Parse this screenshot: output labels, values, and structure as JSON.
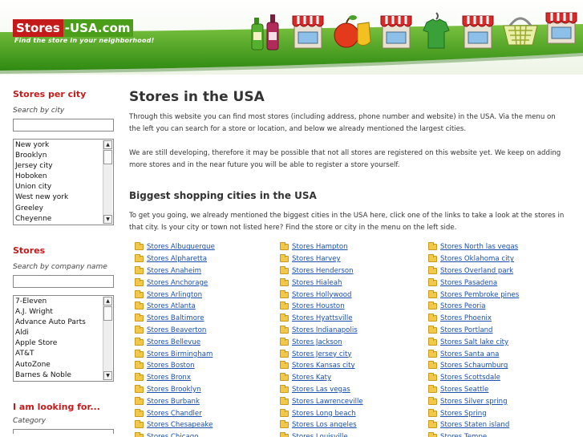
{
  "header": {
    "logo_part1": "Stores",
    "logo_part2": "-USA.com",
    "tagline": "Find the store in your neighborhood!",
    "icons": [
      "bottles-icon",
      "storefront-icon",
      "fruit-icon",
      "storefront-icon",
      "tshirt-icon",
      "storefront-icon",
      "basket-icon",
      "storefront-icon"
    ],
    "colors": {
      "logo_red": "#c41a1a",
      "logo_green": "#4a9e1a",
      "band_green": "#3d9a1c"
    }
  },
  "sidebar": {
    "city": {
      "title": "Stores per city",
      "label": "Search by city",
      "value": "",
      "options": [
        "New york",
        "Brooklyn",
        "Jersey city",
        "Hoboken",
        "Union city",
        "West new york",
        "Greeley",
        "Cheyenne"
      ]
    },
    "company": {
      "title": "Stores",
      "label": "Search by company name",
      "value": "",
      "options": [
        "7-Eleven",
        "A.J. Wright",
        "Advance Auto Parts",
        "Aldi",
        "Apple Store",
        "AT&T",
        "AutoZone",
        "Barnes & Noble"
      ]
    },
    "looking": {
      "title": "I am looking for...",
      "label": "Category"
    }
  },
  "main": {
    "title": "Stores in the USA",
    "intro": "Through this website you can find most stores (including address, phone number and website) in the USA. Via the menu on the left you can search for a store or location, and below we already mentioned the largest cities.",
    "dev_note": "We are still developing, therefore it may be possible that not all stores are registered on this website yet. We keep on adding more stores and in the near future you will be able to register a store yourself.",
    "subtitle": "Biggest shopping cities in the USA",
    "sub_intro": "To get you going, we already mentioned the biggest cities in the USA here, click one of the links to take a look at the stores in that city. Is your city or town not listed here? Find the store or city in the menu on the left side.",
    "columns": [
      [
        "Stores Albuquerque",
        "Stores Alpharetta",
        "Stores Anaheim",
        "Stores Anchorage",
        "Stores Arlington",
        "Stores Atlanta",
        "Stores Baltimore",
        "Stores Beaverton",
        "Stores Bellevue",
        "Stores Birmingham",
        "Stores Boston",
        "Stores Bronx",
        "Stores Brooklyn",
        "Stores Burbank",
        "Stores Chandler",
        "Stores Chesapeake",
        "Stores Chicago"
      ],
      [
        "Stores Hampton",
        "Stores Harvey",
        "Stores Henderson",
        "Stores Hialeah",
        "Stores Hollywood",
        "Stores Houston",
        "Stores Hyattsville",
        "Stores Indianapolis",
        "Stores Jackson",
        "Stores Jersey city",
        "Stores Kansas city",
        "Stores Katy",
        "Stores Las vegas",
        "Stores Lawrenceville",
        "Stores Long beach",
        "Stores Los angeles",
        "Stores Louisville"
      ],
      [
        "Stores North las vegas",
        "Stores Oklahoma city",
        "Stores Overland park",
        "Stores Pasadena",
        "Stores Pembroke pines",
        "Stores Peoria",
        "Stores Phoenix",
        "Stores Portland",
        "Stores Salt lake city",
        "Stores Santa ana",
        "Stores Schaumburg",
        "Stores Scottsdale",
        "Stores Seattle",
        "Stores Silver spring",
        "Stores Spring",
        "Stores Staten island",
        "Stores Tempe"
      ]
    ]
  }
}
